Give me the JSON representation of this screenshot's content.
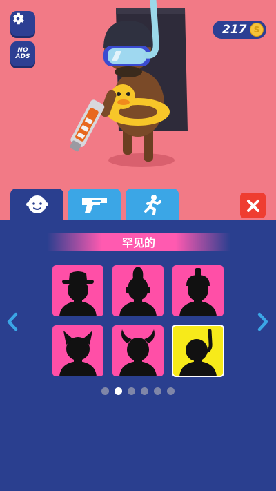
{
  "hud": {
    "noads_line1": "NO",
    "noads_line2": "ADS",
    "coin_count": "217",
    "coin_symbol": "S"
  },
  "tabs": [
    {
      "name": "head",
      "icon": "character-head-icon",
      "active": true
    },
    {
      "name": "weapon",
      "icon": "blaster-gun-icon",
      "active": false
    },
    {
      "name": "pose",
      "icon": "running-figure-icon",
      "active": false
    }
  ],
  "panel": {
    "rarity_label": "罕见的",
    "items": [
      {
        "silhouette": "cowboy-hat-head-icon",
        "selected": false
      },
      {
        "silhouette": "mohawk-head-icon",
        "selected": false
      },
      {
        "silhouette": "crested-helmet-head-icon",
        "selected": false
      },
      {
        "silhouette": "cat-ears-head-icon",
        "selected": false
      },
      {
        "silhouette": "horned-helmet-head-icon",
        "selected": false
      },
      {
        "silhouette": "snorkel-mask-head-icon",
        "selected": true
      }
    ],
    "page_count": 6,
    "current_page": 2
  },
  "colors": {
    "scene_bg": "#f27a86",
    "panel_bg": "#2a3f8f",
    "tab_inactive": "#3ba6e6",
    "card_pink": "#ff4fa7",
    "card_selected": "#f7ea1a",
    "close_red": "#ef3d31"
  }
}
